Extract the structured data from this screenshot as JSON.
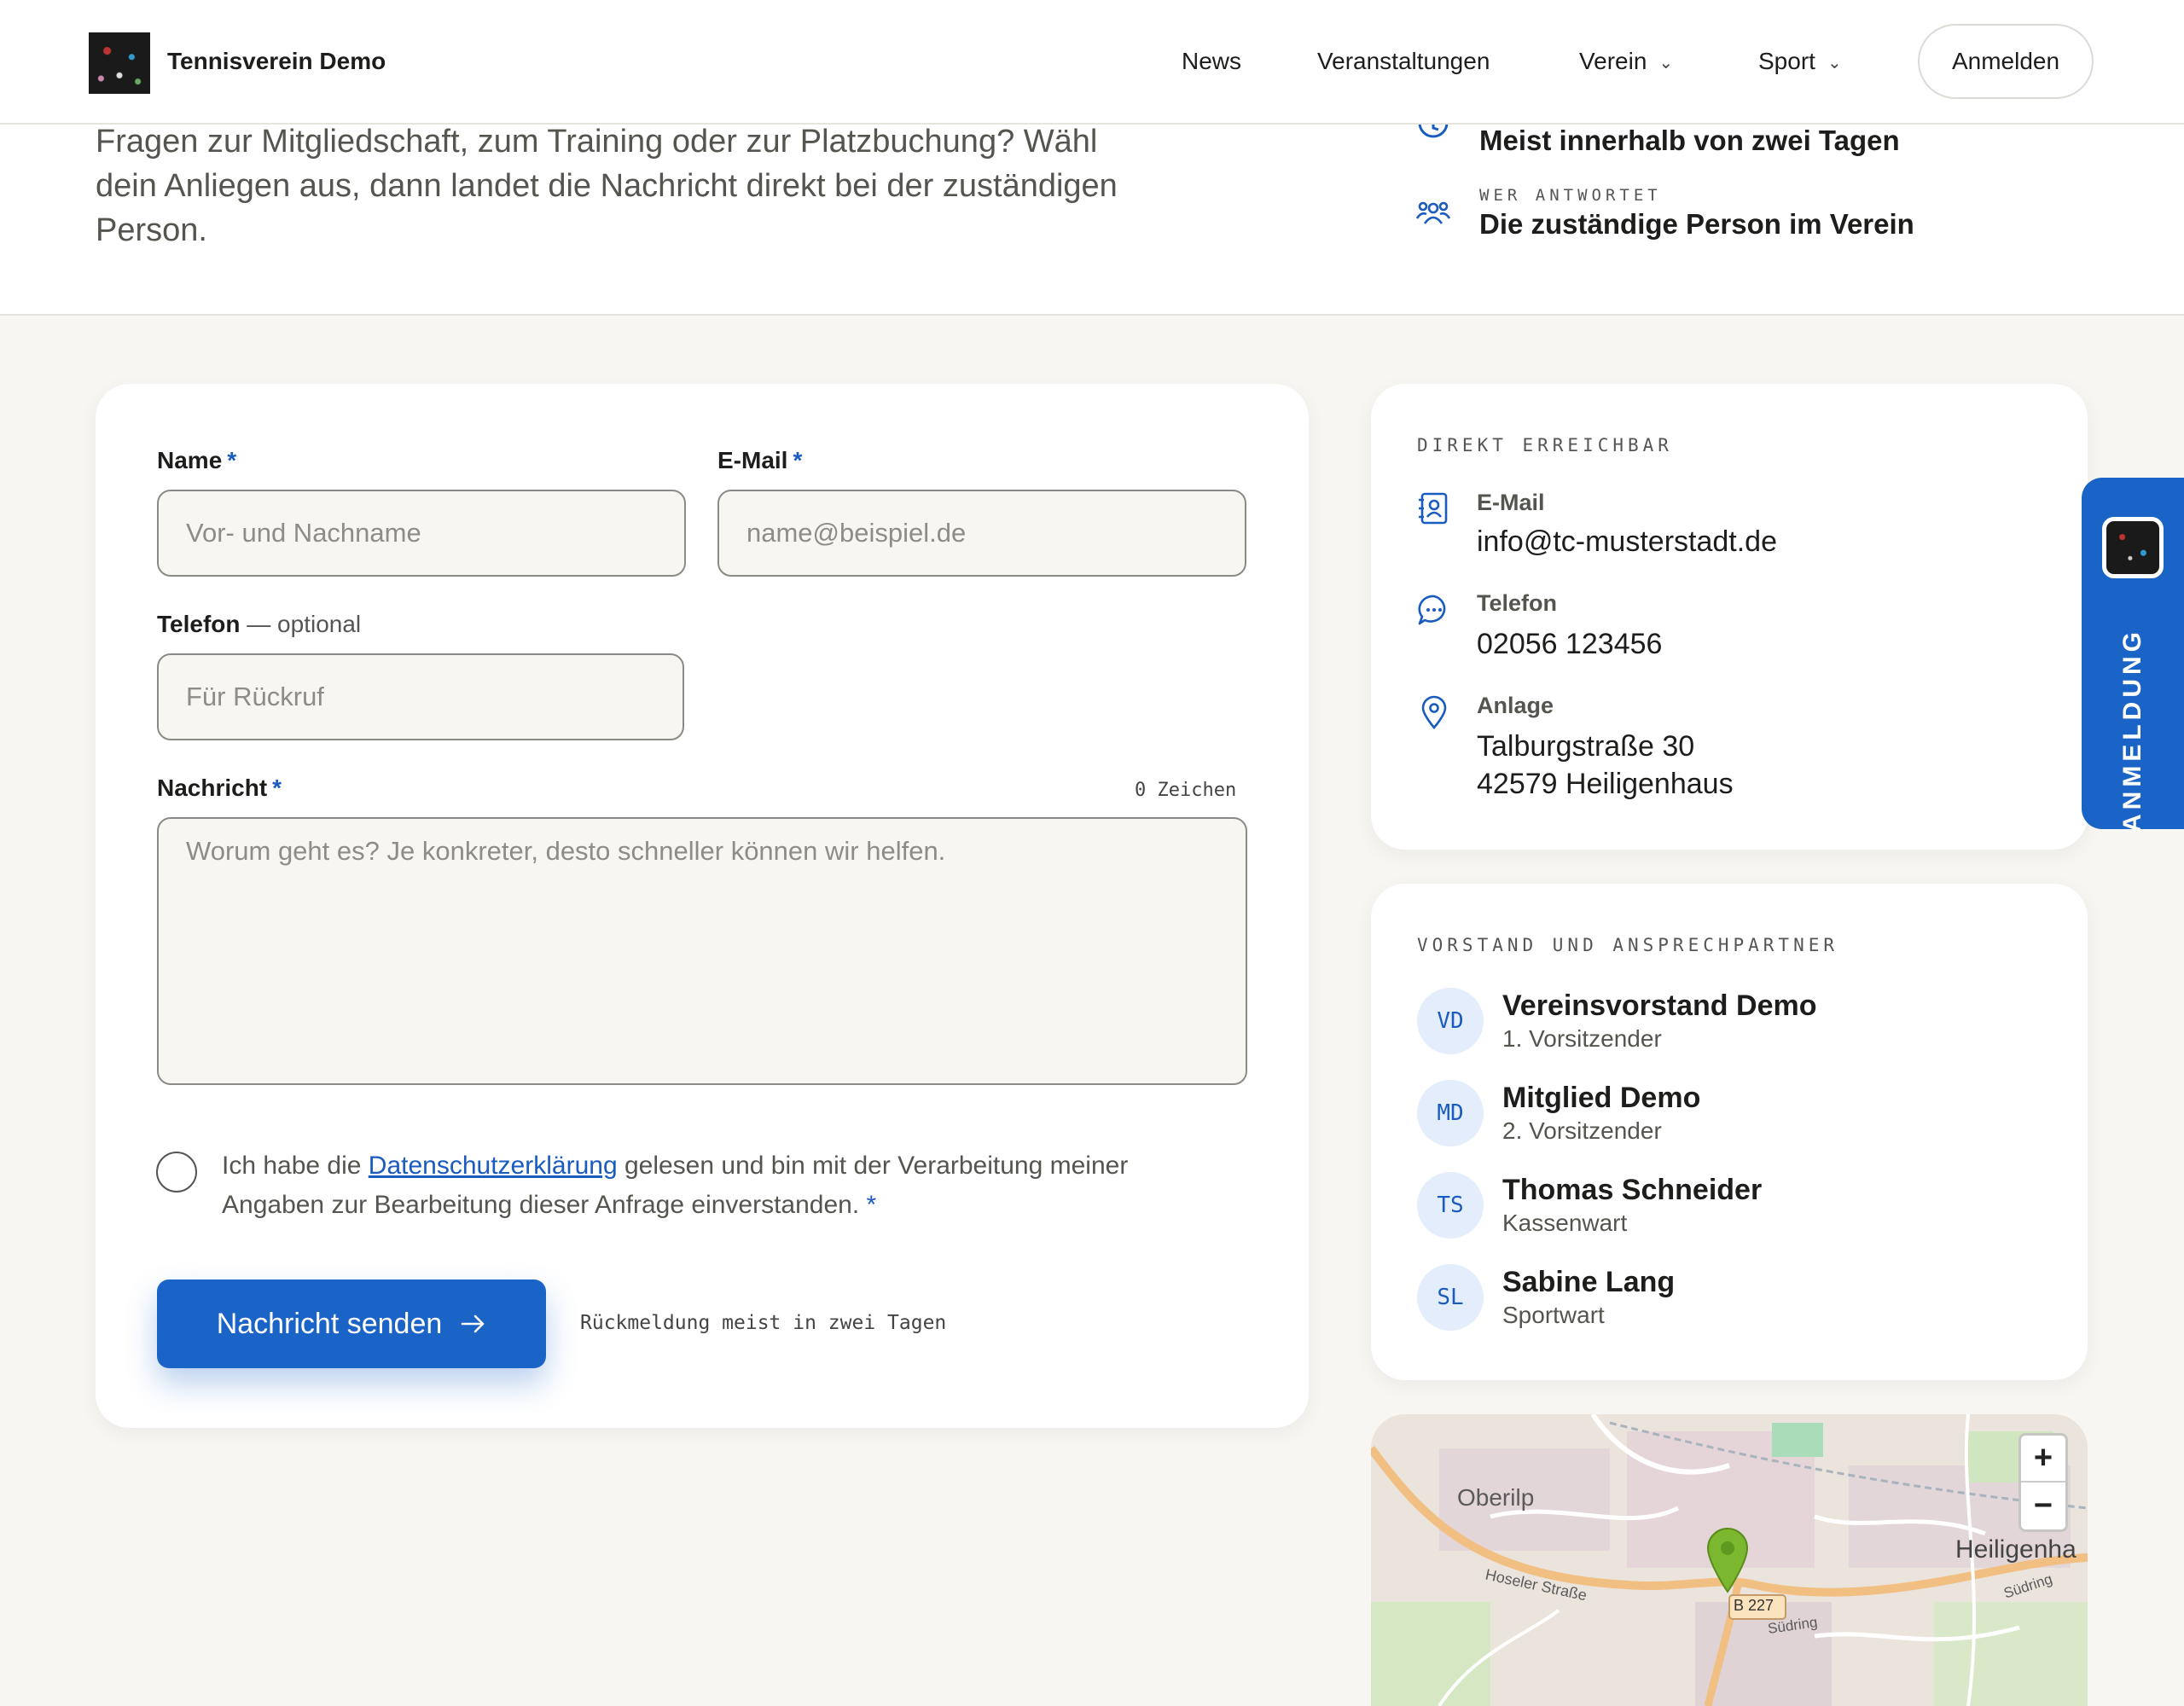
{
  "header": {
    "brand": "Tennisverein Demo",
    "nav": [
      {
        "label": "News"
      },
      {
        "label": "Veranstaltungen"
      },
      {
        "label": "Verein",
        "has_dropdown": true
      },
      {
        "label": "Sport",
        "has_dropdown": true
      }
    ],
    "login_label": "Anmelden"
  },
  "hero": {
    "text": "Fragen zur Mitgliedschaft, zum Training oder zur Platzbuchung? Wähl dein Anliegen aus, dann landet die Nachricht direkt bei der zuständigen Person.",
    "response_time_value": "Meist innerhalb von zwei Tagen",
    "who_kicker": "WER ANTWORTET",
    "who_value": "Die zuständige Person im Verein"
  },
  "form": {
    "name_label": "Name",
    "name_placeholder": "Vor- und Nachname",
    "email_label": "E-Mail",
    "email_placeholder": "name@beispiel.de",
    "phone_label": "Telefon",
    "phone_optional": " — optional",
    "phone_placeholder": "Für Rückruf",
    "message_label": "Nachricht",
    "message_counter": "0 Zeichen",
    "message_placeholder": "Worum geht es? Je konkreter, desto schneller können wir helfen.",
    "required_mark": "*",
    "consent_before": "Ich habe die ",
    "consent_link": "Datenschutzerklärung",
    "consent_after": " gelesen und bin mit der Verarbeitung meiner Angaben zur Bearbeitung dieser Anfrage einverstanden.",
    "submit_label": "Nachricht senden",
    "submit_note": "Rückmeldung meist in zwei Tagen"
  },
  "contact": {
    "kicker": "DIREKT ERREICHBAR",
    "email_label": "E-Mail",
    "email_value": "info@tc-musterstadt.de",
    "phone_label": "Telefon",
    "phone_value": "02056 123456",
    "address_label": "Anlage",
    "address_line1": "Talburgstraße 30",
    "address_line2": "42579 Heiligenhaus"
  },
  "team": {
    "kicker": "VORSTAND UND ANSPRECHPARTNER",
    "people": [
      {
        "initials": "VD",
        "name": "Vereinsvorstand Demo",
        "role": "1. Vorsitzender"
      },
      {
        "initials": "MD",
        "name": "Mitglied Demo",
        "role": "2. Vorsitzender"
      },
      {
        "initials": "TS",
        "name": "Thomas Schneider",
        "role": "Kassenwart"
      },
      {
        "initials": "SL",
        "name": "Sabine Lang",
        "role": "Sportwart"
      }
    ]
  },
  "side_tab": {
    "label": "ANMELDUNG"
  },
  "map": {
    "labels": {
      "oberilp": "Oberilp",
      "heiligenhaus": "Heiligenha",
      "hoseler": "Hoseler Straße",
      "b227": "B 227",
      "suedring": "Südring"
    },
    "zoom_in": "+",
    "zoom_out": "−"
  },
  "colors": {
    "accent": "#1a63c7",
    "background": "#f7f6f2",
    "marker": "#7cb82f"
  }
}
